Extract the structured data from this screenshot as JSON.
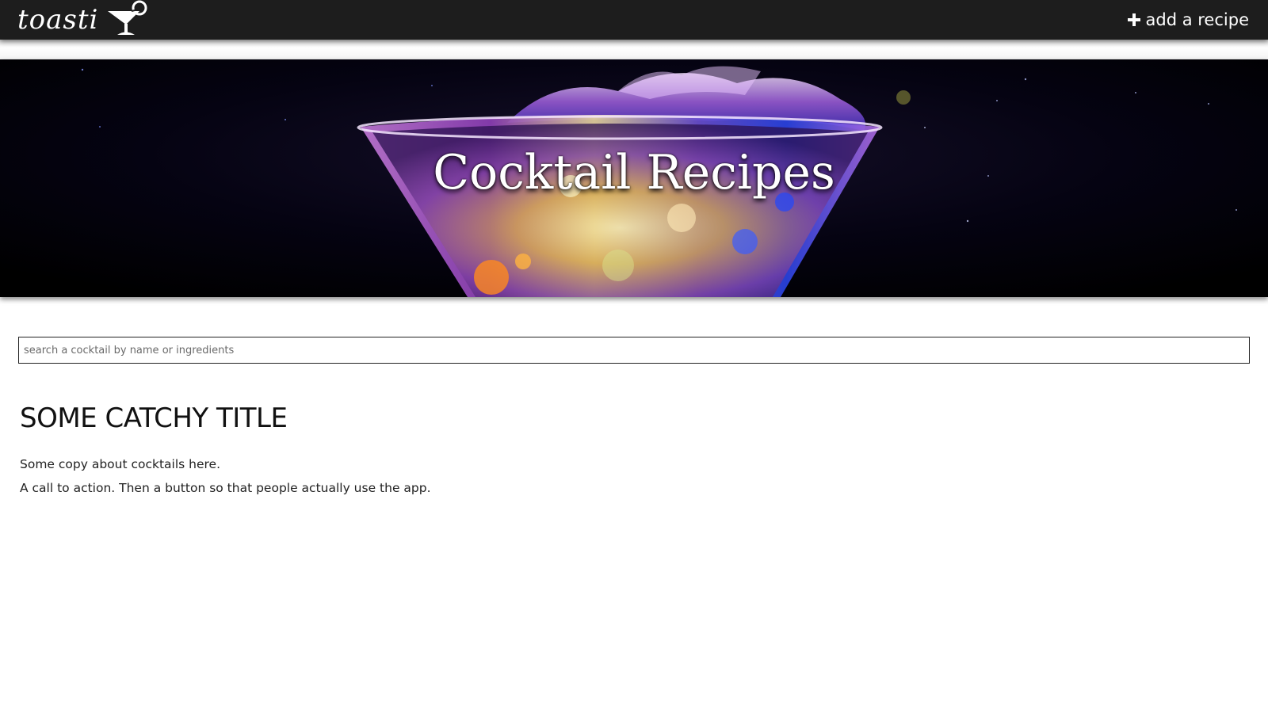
{
  "header": {
    "brand": "toasti",
    "brand_icon": "cocktail-glass-icon",
    "add_recipe_label": "add a recipe",
    "add_icon": "plus-icon",
    "background_color": "#1d1d1d"
  },
  "hero": {
    "title": "Cocktail Recipes",
    "image": "cocktail-splash-photo"
  },
  "search": {
    "placeholder": "search a cocktail by name or ingredients",
    "value": ""
  },
  "main": {
    "title": "SOME CATCHY TITLE",
    "paragraphs": [
      "Some copy about cocktails here.",
      "A call to action. Then a button so that people actually use the app."
    ]
  }
}
